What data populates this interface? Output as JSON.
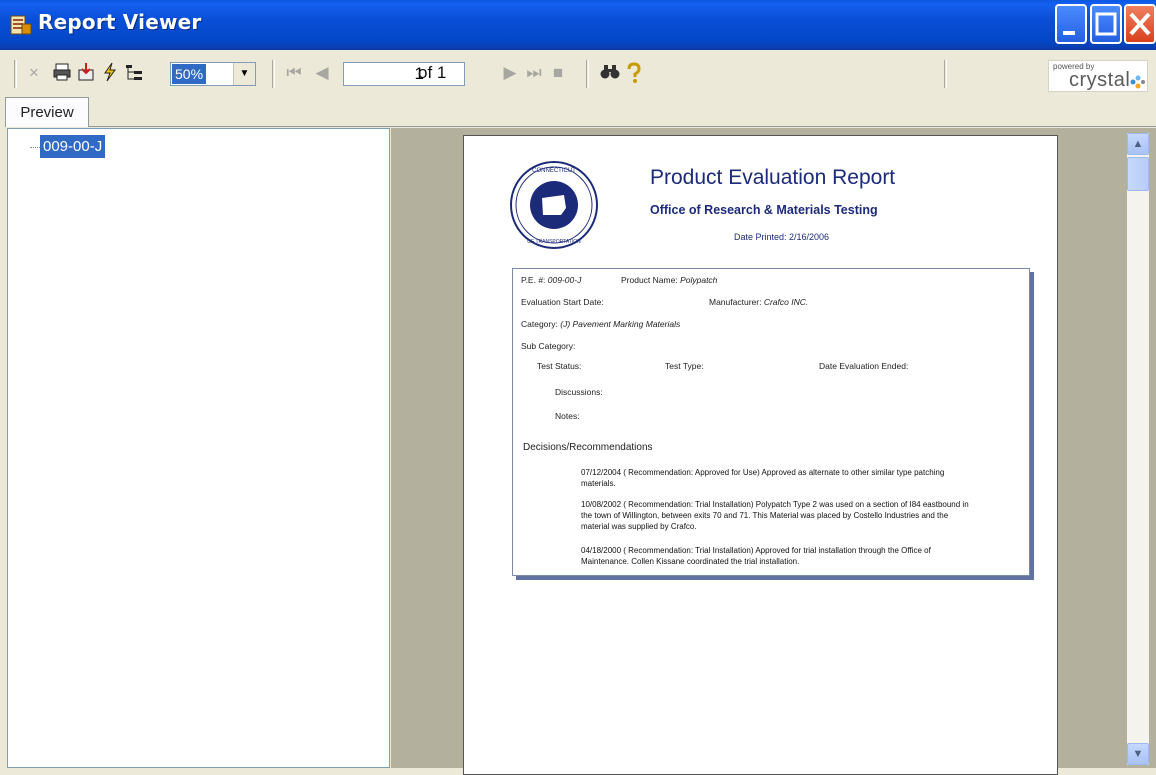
{
  "window": {
    "title": "Report Viewer"
  },
  "toolbar": {
    "zoom_value": "50%",
    "page_number": "1",
    "page_of": "of 1",
    "icons": [
      "close-icon",
      "print-icon",
      "export-icon",
      "refresh-icon",
      "group-tree-icon",
      "first-page-icon",
      "previous-page-icon",
      "next-page-icon",
      "last-page-icon",
      "stop-icon",
      "find-icon",
      "help-icon"
    ],
    "branding_powered_by": "powered by",
    "branding_name": "crystal"
  },
  "tabs": {
    "preview": "Preview"
  },
  "tree": {
    "selected_node": "009-00-J"
  },
  "report": {
    "title": "Product Evaluation Report",
    "subtitle": "Office of Research & Materials Testing",
    "date_printed": "Date Printed: 2/16/2006",
    "pe_label": "P.E. #:",
    "pe_value": "009-00-J",
    "product_label": "Product Name:",
    "product_value": "Polypatch",
    "eval_start_label": "Evaluation Start Date:",
    "manufacturer_label": "Manufacturer:",
    "manufacturer_value": "Crafco INC.",
    "category_label": "Category:",
    "category_value": "(J) Pavement Marking Materials",
    "subcategory_label": "Sub Category:",
    "test_status_label": "Test Status:",
    "test_type_label": "Test Type:",
    "date_eval_ended_label": "Date Evaluation Ended:",
    "discussions_label": "Discussions:",
    "notes_label": "Notes:",
    "decisions_title": "Decisions/Recommendations",
    "recommendations": [
      "07/12/2004 ( Recommendation: Approved for Use) Approved as alternate to other similar type patching materials.",
      "10/08/2002 ( Recommendation: Trial Installation) Polypatch Type 2 was used on a section of I84 eastbound in the town of Willington, between exits 70 and 71. This Material was placed by Costello Industries and the material was supplied by Crafco.",
      "04/18/2000 ( Recommendation: Trial Installation) Approved for trial installation through the Office of Maintenance. Collen Kissane coordinated the trial installation."
    ]
  },
  "colors": {
    "titlebar": "#0347c8",
    "selection": "#316ac5",
    "report_heading": "#1c2a7a"
  }
}
